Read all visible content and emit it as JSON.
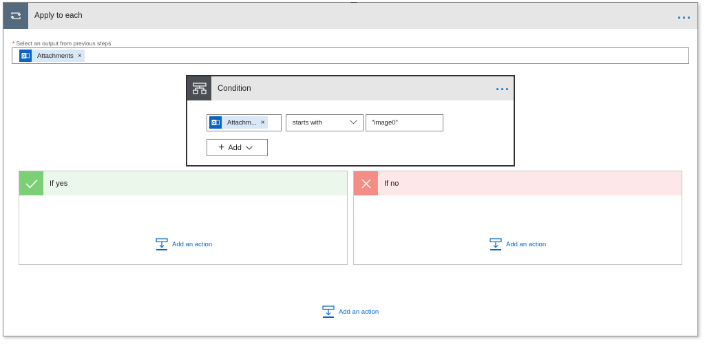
{
  "loop": {
    "title": "Apply to each",
    "more_label": "···"
  },
  "output_field": {
    "required_marker": "*",
    "label": "Select an output from previous steps",
    "token": {
      "label": "Attachments",
      "remove": "×"
    }
  },
  "condition": {
    "title": "Condition",
    "more_label": "···",
    "operand_token": {
      "label": "Attachm...",
      "remove": "×"
    },
    "operator": "starts with",
    "value": "\"image0\"",
    "add_label": "Add"
  },
  "branches": {
    "yes": {
      "title": "If yes",
      "add_action_label": "Add an action"
    },
    "no": {
      "title": "If no",
      "add_action_label": "Add an action"
    }
  },
  "footer": {
    "add_action_label": "Add an action"
  },
  "icons": {
    "loop": "loop-icon",
    "condition": "condition-icon",
    "outlook": "outlook-icon",
    "check": "check-icon",
    "close": "close-icon",
    "add_action": "add-action-icon",
    "chevron": "chevron-down-icon"
  },
  "colors": {
    "loop_header": "#546a7d",
    "condition_header": "#4b4f54",
    "yes_accent": "#7bd075",
    "yes_bg": "#eaf7ea",
    "no_accent": "#f38d86",
    "no_bg": "#fde7e9",
    "link": "#0066cc",
    "token_bg": "#d9e8f6"
  }
}
